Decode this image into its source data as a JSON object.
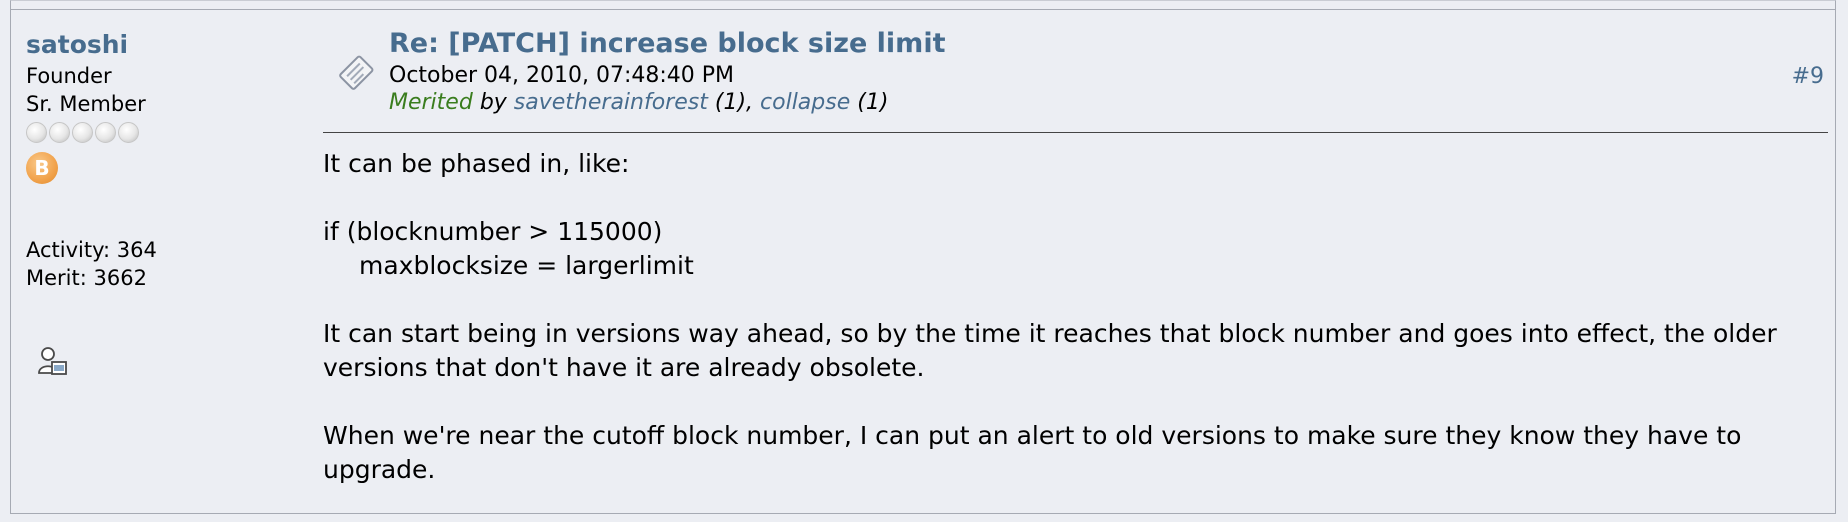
{
  "poster": {
    "name": "satoshi",
    "title": "Founder",
    "rank": "Sr. Member",
    "badge_symbol": "B",
    "activity": "Activity: 364",
    "merit": "Merit: 3662"
  },
  "post": {
    "subject": "Re: [PATCH] increase block size limit",
    "date": "October 04, 2010, 07:48:40 PM",
    "merited_label": "Merited",
    "merited_by": "by",
    "merit_user1": "savetherainforest",
    "merit_count1": "(1)",
    "merit_sep": ",",
    "merit_user2": "collapse",
    "merit_count2": "(1)",
    "number": "#9",
    "body": {
      "line1": "It can be phased in, like:",
      "code1": "if (blocknumber > 115000)",
      "code2": "maxblocksize = largerlimit",
      "para2": "It can start being in versions way ahead, so by the time it reaches that block number and goes into effect, the older versions that don't have it are already obsolete.",
      "para3": "When we're near the cutoff block number, I can put an alert to old versions to make sure they know they have to upgrade."
    }
  },
  "colors": {
    "link": "#476c8e",
    "merited": "#3a7d1e",
    "background": "#eceef3"
  },
  "icons": [
    "star-rating-icon",
    "bitcoin-badge-icon",
    "profile-icon",
    "post-icon"
  ]
}
